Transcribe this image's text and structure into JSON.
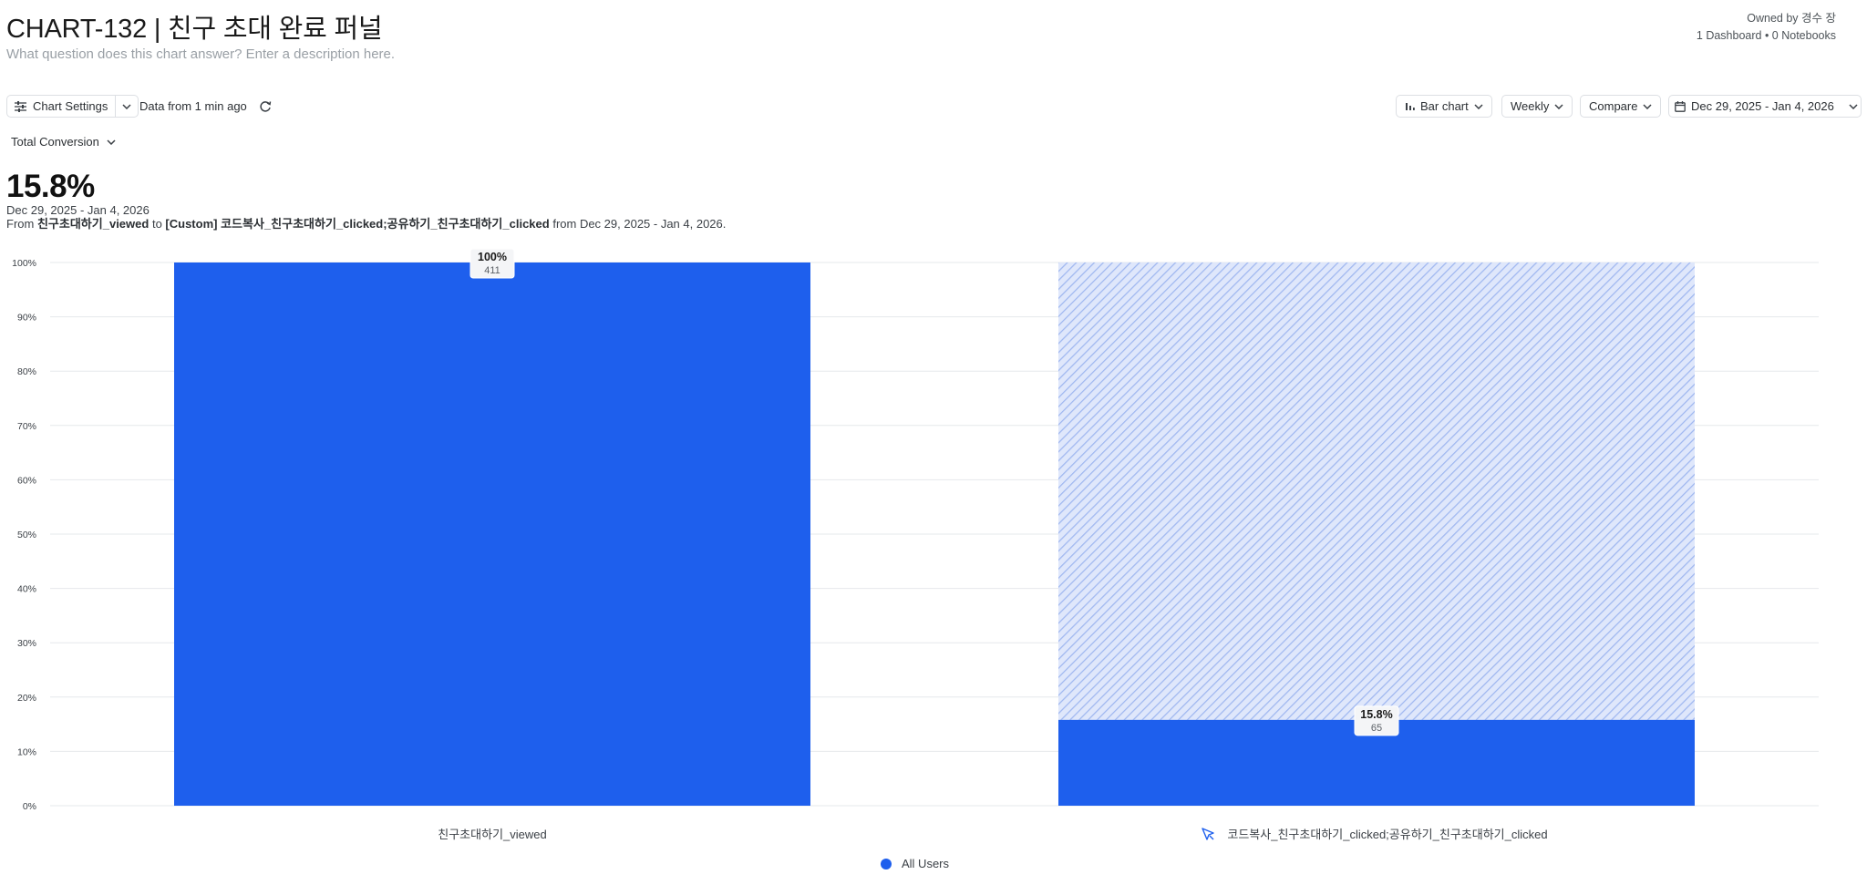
{
  "header": {
    "title": "CHART-132 | 친구 초대 완료 퍼널",
    "description": "What question does this chart answer? Enter a description here.",
    "owner": "Owned by 경수 장",
    "links": "1 Dashboard • 0 Notebooks"
  },
  "toolbar": {
    "chart_settings": "Chart Settings",
    "data_from": "Data from 1 min ago",
    "chart_type": "Bar chart",
    "interval": "Weekly",
    "compare": "Compare",
    "date_range": "Dec 29, 2025 - Jan 4, 2026"
  },
  "metric": {
    "selector": "Total Conversion",
    "value": "15.8%",
    "range": "Dec 29, 2025 - Jan 4, 2026",
    "from_prefix": "From",
    "from_event": "친구초대하기_viewed",
    "to_word": "to",
    "to_event": "[Custom] 코드복사_친구초대하기_clicked;공유하기_친구초대하기_clicked",
    "from_suffix": "from Dec 29, 2025 - Jan 4, 2026."
  },
  "colors": {
    "bar": "#1e5fed",
    "dropoff": "#c7d5f8",
    "grid": "#e6e8eb"
  },
  "chart_data": {
    "type": "bar",
    "categories": [
      "친구초대하기_viewed",
      "코드복사_친구초대하기_clicked;공유하기_친구초대하기_clicked"
    ],
    "series": [
      {
        "name": "All Users",
        "values": [
          100,
          15.8
        ],
        "counts": [
          411,
          65
        ],
        "labels": [
          "100%",
          "15.8%"
        ],
        "counts_labels": [
          "411",
          "65"
        ]
      }
    ],
    "dropoff_shown": [
      false,
      true
    ],
    "y_ticks": [
      "0%",
      "10%",
      "20%",
      "30%",
      "40%",
      "50%",
      "60%",
      "70%",
      "80%",
      "90%",
      "100%"
    ],
    "ylim": [
      0,
      100
    ],
    "grid": true,
    "legend": "bottom-center",
    "second_step_icon": "custom-event-cursor-icon"
  },
  "legend": {
    "label": "All Users"
  }
}
